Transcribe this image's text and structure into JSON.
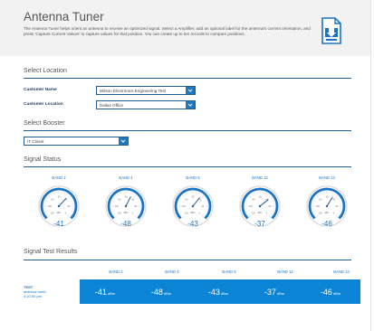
{
  "header": {
    "title": "Antenna Tuner",
    "description": "The Antenna Tuner helps orient an antenna to receive an optimized signal. Select a Amplifier, add an optional label for the antenna's current orientation, and press 'Capture Current Values' to capture values for that position. You can create up to ten records to compare positions.",
    "save_icon": "save-document-icon"
  },
  "location": {
    "title": "Select Location",
    "customer_name_label": "Customer Name",
    "customer_name_value": "Wilson Electronics Engineering Test",
    "customer_location_label": "Customer Location",
    "customer_location_value": "Dallas Office"
  },
  "booster": {
    "title": "Select Booster",
    "value": "IT Closet"
  },
  "signal_status": {
    "title": "Signal Status",
    "scale_ticks": [
      "-120",
      "-100",
      "-80",
      "-60",
      "-40",
      "-20",
      "0"
    ],
    "unit": "dBm",
    "gauges": [
      {
        "band": "BAND 2",
        "value": "-41",
        "level": -41
      },
      {
        "band": "BAND 4",
        "value": "-48",
        "level": -48
      },
      {
        "band": "BAND 5",
        "value": "-43",
        "level": -43
      },
      {
        "band": "BAND 12",
        "value": "-37",
        "level": -37
      },
      {
        "band": "BAND 13",
        "value": "-46",
        "level": -46
      }
    ],
    "accent": "#1a73c4"
  },
  "results": {
    "title": "Signal Test Results",
    "columns": [
      "BAND 2",
      "BAND 4",
      "BAND 5",
      "BAND 12",
      "BAND 13"
    ],
    "row": {
      "label_line1": "TEST",
      "label_line2": "antenna north",
      "label_line3": "4:10:50 pm",
      "values": [
        "-41",
        "-48",
        "-43",
        "-37",
        "-46"
      ],
      "unit": "dBm"
    },
    "bar_color": "#0b84d6"
  }
}
